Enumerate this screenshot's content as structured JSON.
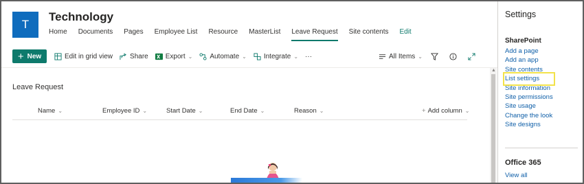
{
  "site": {
    "logo_letter": "T",
    "title": "Technology",
    "nav": [
      "Home",
      "Documents",
      "Pages",
      "Employee List",
      "Resource",
      "MasterList",
      "Leave Request",
      "Site contents"
    ],
    "nav_active_index": 6,
    "edit_label": "Edit"
  },
  "commandbar": {
    "new_label": "New",
    "grid_view_label": "Edit in grid view",
    "share_label": "Share",
    "export_label": "Export",
    "automate_label": "Automate",
    "integrate_label": "Integrate",
    "more_label": "···",
    "view_label": "All Items"
  },
  "list": {
    "title": "Leave Request",
    "columns": [
      "Name",
      "Employee ID",
      "Start Date",
      "End Date",
      "Reason"
    ],
    "add_column_label": "Add column"
  },
  "settings_panel": {
    "title": "Settings",
    "section_title": "SharePoint",
    "links": [
      "Add a page",
      "Add an app",
      "Site contents",
      "List settings",
      "Site information",
      "Site permissions",
      "Site usage",
      "Change the look",
      "Site designs"
    ],
    "highlighted_link": "List settings",
    "office_title": "Office 365",
    "view_all_label": "View all"
  },
  "colors": {
    "accent": "#0e7a6c",
    "logo_bg": "#0f6cbd",
    "link": "#0f5fa8",
    "highlight": "#f2e24a"
  }
}
